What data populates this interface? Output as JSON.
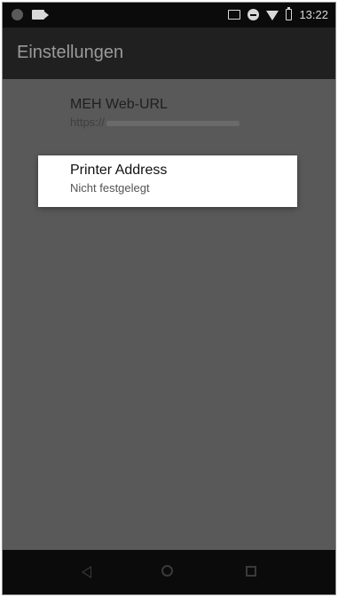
{
  "status_bar": {
    "time": "13:22",
    "icons": [
      "notification-dot-icon",
      "video-camera-icon",
      "cast-icon",
      "do-not-disturb-icon",
      "wifi-icon",
      "battery-icon"
    ]
  },
  "toolbar": {
    "title": "Einstellungen"
  },
  "preferences": {
    "web_url": {
      "title": "MEH Web-URL",
      "summary": "https://"
    },
    "printer_address": {
      "title": "Printer Address",
      "summary": "Nicht festgelegt"
    }
  },
  "nav_bar": {
    "icons": [
      "back-icon",
      "home-icon",
      "recent-apps-icon"
    ]
  },
  "colors": {
    "toolbar_bg": "#202020",
    "content_dim_bg": "#595959",
    "dialog_bg": "#ffffff"
  }
}
